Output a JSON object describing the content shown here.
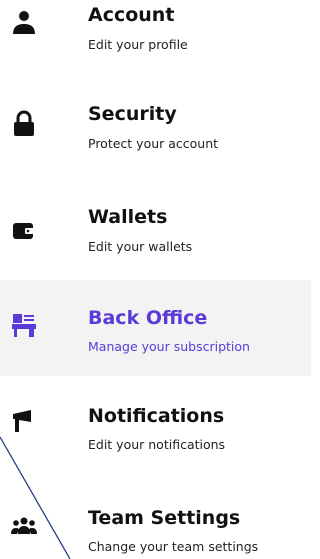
{
  "menu": {
    "items": [
      {
        "title": "Account",
        "subtitle": "Edit your profile",
        "icon": "user-icon"
      },
      {
        "title": "Security",
        "subtitle": "Protect your account",
        "icon": "lock-icon"
      },
      {
        "title": "Wallets",
        "subtitle": "Edit your wallets",
        "icon": "wallet-icon"
      },
      {
        "title": "Back Office",
        "subtitle": "Manage your subscription",
        "icon": "office-icon",
        "active": true
      },
      {
        "title": "Notifications",
        "subtitle": "Edit your notifications",
        "icon": "megaphone-icon"
      },
      {
        "title": "Team Settings",
        "subtitle": "Change your team settings",
        "icon": "team-icon"
      }
    ]
  },
  "colors": {
    "accent": "#5b3bd8",
    "text": "#111111",
    "active_bg": "#f3f3f4",
    "line": "#2b3f86"
  }
}
